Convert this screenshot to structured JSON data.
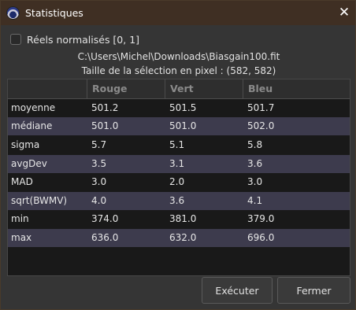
{
  "window": {
    "title": "Statistiques",
    "close_glyph": "✕"
  },
  "options": {
    "normalized_label": "Réels normalisés [0, 1]",
    "normalized_checked": false
  },
  "info": {
    "file_path": "C:\\Users\\Michel\\Downloads\\Biasgain100.fit",
    "selection_size": "Taille de la sélection en pixel : (582, 582)"
  },
  "table": {
    "columns": [
      "",
      "Rouge",
      "Vert",
      "Bleu"
    ],
    "rows": [
      {
        "label": "moyenne",
        "r": "501.2",
        "g": "501.5",
        "b": "501.7"
      },
      {
        "label": "médiane",
        "r": "501.0",
        "g": "501.0",
        "b": "502.0"
      },
      {
        "label": "sigma",
        "r": "5.7",
        "g": "5.1",
        "b": "5.8"
      },
      {
        "label": "avgDev",
        "r": "3.5",
        "g": "3.1",
        "b": "3.6"
      },
      {
        "label": "MAD",
        "r": "3.0",
        "g": "2.0",
        "b": "3.0"
      },
      {
        "label": "sqrt(BWMV)",
        "r": "4.0",
        "g": "3.6",
        "b": "4.1"
      },
      {
        "label": "min",
        "r": "374.0",
        "g": "381.0",
        "b": "379.0"
      },
      {
        "label": "max",
        "r": "636.0",
        "g": "632.0",
        "b": "696.0"
      }
    ]
  },
  "buttons": {
    "execute_label": "Exécuter",
    "close_label": "Fermer"
  },
  "icons": {
    "app": "siril-app-icon",
    "close": "close-icon"
  },
  "colors": {
    "titlebar": "#3f2f23",
    "background": "#353535",
    "table_bg": "#191919",
    "row_alt": "#3d3b4d",
    "header_text": "#8a8a8a"
  }
}
